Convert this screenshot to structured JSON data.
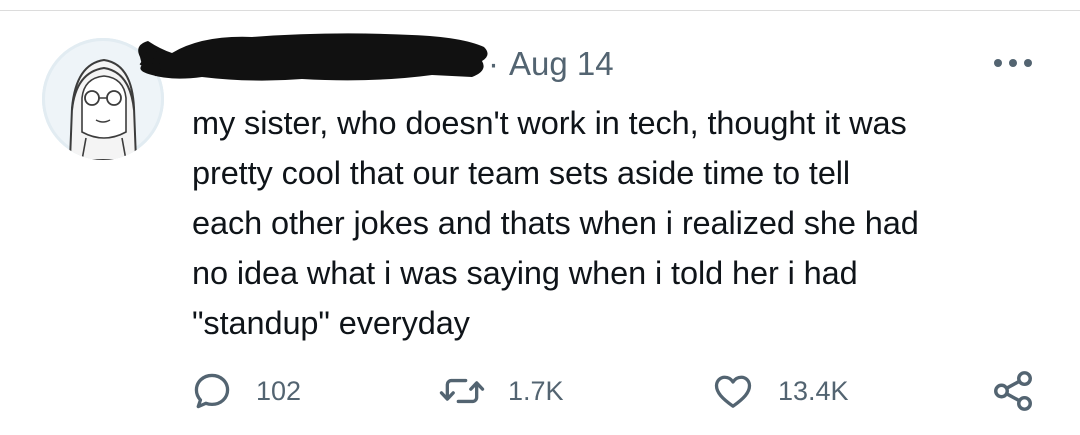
{
  "tweet": {
    "separator": "·",
    "date": "Aug 14",
    "text": "my sister, who doesn't work in tech, thought it was\npretty cool that our team sets aside time to tell\neach other jokes and thats when i realized she had\nno idea what i was saying when i told her i had\n\"standup\" everyday"
  },
  "actions": {
    "reply": {
      "icon": "reply-icon",
      "count": "102"
    },
    "retweet": {
      "icon": "retweet-icon",
      "count": "1.7K"
    },
    "like": {
      "icon": "heart-icon",
      "count": "13.4K"
    },
    "share": {
      "icon": "share-icon"
    }
  },
  "colors": {
    "text": "#0f1419",
    "secondary": "#536471",
    "redaction": "#111111"
  }
}
